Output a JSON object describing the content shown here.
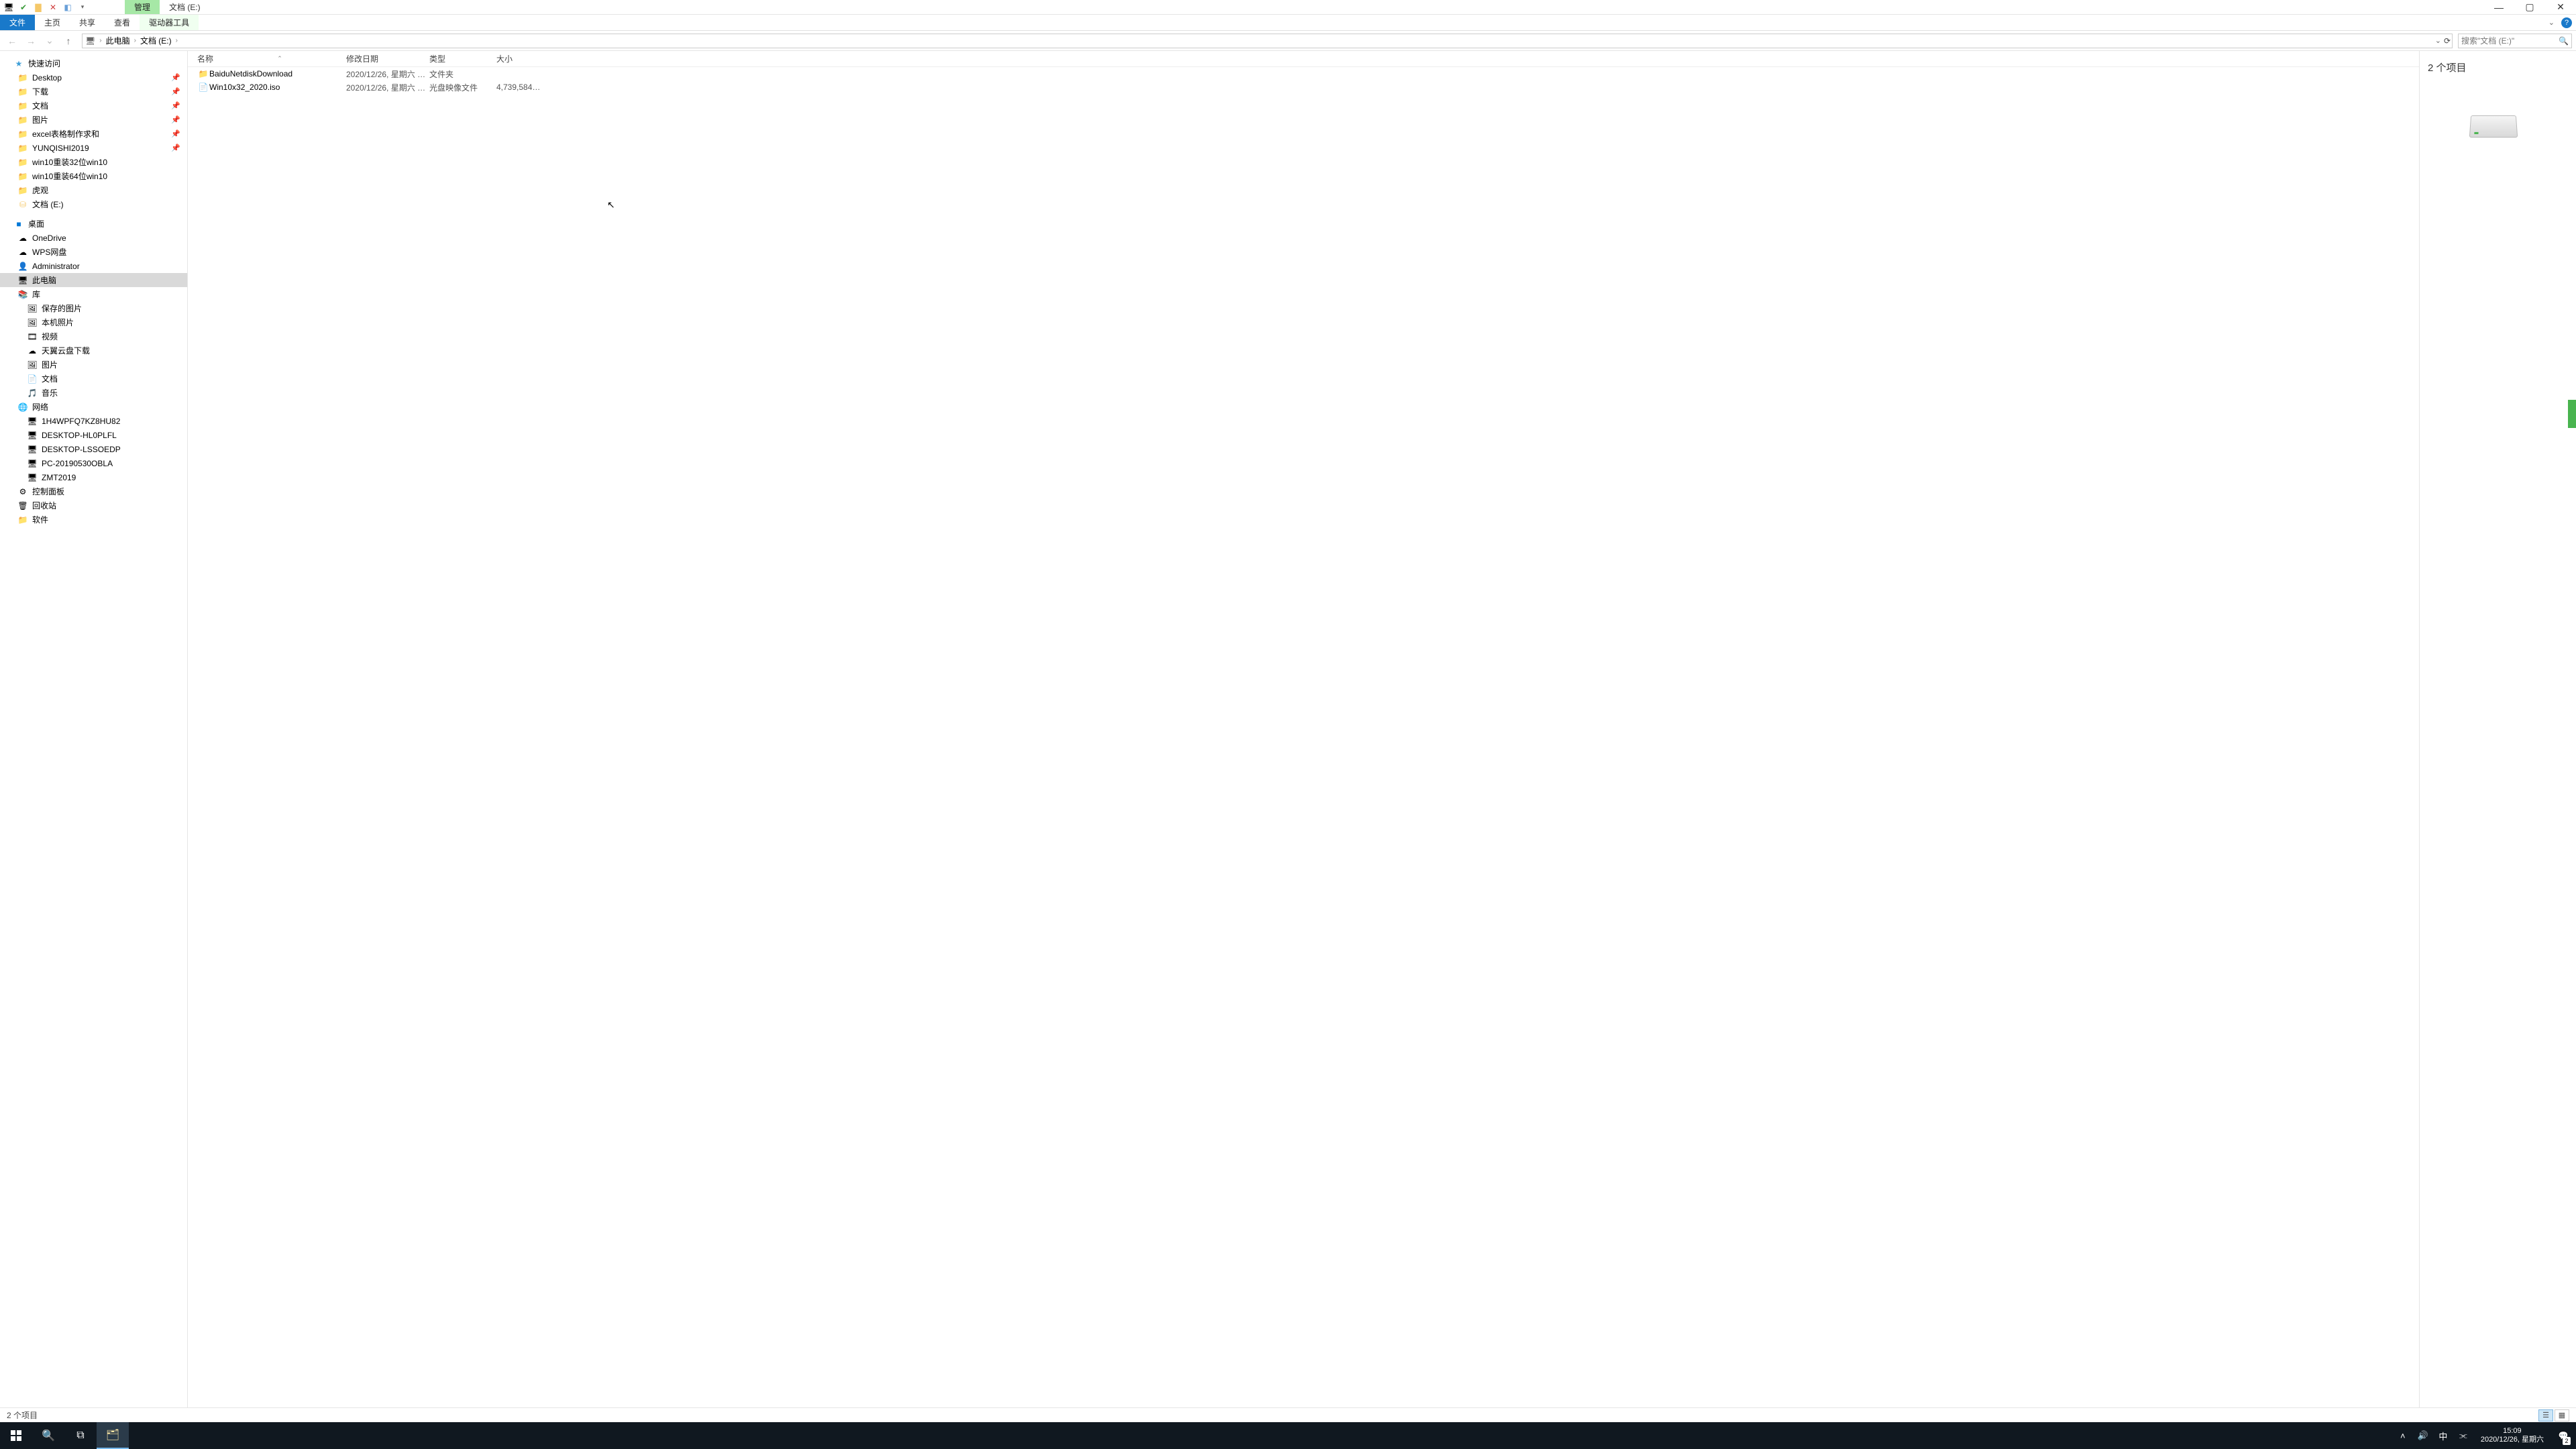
{
  "titlebar": {
    "qat_icons": [
      "pc-icon",
      "check-icon",
      "folder-icon",
      "close-x-icon",
      "props-icon",
      "dropdown-icon"
    ],
    "contextual_tab": "管理",
    "window_title": "文档 (E:)"
  },
  "ribbon": {
    "file": "文件",
    "tabs": [
      "主页",
      "共享",
      "查看"
    ],
    "contextual_sub": "驱动器工具",
    "expand_icon": "chevron-down-icon",
    "help_icon": "help-icon"
  },
  "nav": {
    "back": "←",
    "forward": "→",
    "recent": "⌄",
    "up": "↑",
    "breadcrumb": [
      "此电脑",
      "文档 (E:)"
    ],
    "addr_dropdown": "⌄",
    "refresh": "⟳",
    "search_placeholder": "搜索\"文档 (E:)\""
  },
  "columns": {
    "name": "名称",
    "date": "修改日期",
    "type": "类型",
    "size": "大小"
  },
  "rows": [
    {
      "icon": "folder",
      "name": "BaiduNetdiskDownload",
      "date": "2020/12/26, 星期六 1…",
      "type": "文件夹",
      "size": ""
    },
    {
      "icon": "file",
      "name": "Win10x32_2020.iso",
      "date": "2020/12/26, 星期六 1…",
      "type": "光盘映像文件",
      "size": "4,739,584…"
    }
  ],
  "sidebar": {
    "quick": {
      "label": "快速访问",
      "items": [
        {
          "icon": "folder",
          "label": "Desktop",
          "pin": true
        },
        {
          "icon": "folder",
          "label": "下载",
          "pin": true
        },
        {
          "icon": "folder",
          "label": "文档",
          "pin": true
        },
        {
          "icon": "folder",
          "label": "图片",
          "pin": true
        },
        {
          "icon": "folder",
          "label": "excel表格制作求和",
          "pin": true
        },
        {
          "icon": "folder",
          "label": "YUNQISHI2019",
          "pin": true
        },
        {
          "icon": "folder",
          "label": "win10重装32位win10",
          "pin": false
        },
        {
          "icon": "folder",
          "label": "win10重装64位win10",
          "pin": false
        },
        {
          "icon": "folder",
          "label": "虎观",
          "pin": false
        },
        {
          "icon": "drive",
          "label": "文档 (E:)",
          "pin": false
        }
      ]
    },
    "desktop": {
      "label": "桌面",
      "items": [
        {
          "icon": "cloud",
          "label": "OneDrive"
        },
        {
          "icon": "cloud",
          "label": "WPS网盘"
        },
        {
          "icon": "user",
          "label": "Administrator"
        },
        {
          "icon": "pc",
          "label": "此电脑",
          "selected": true
        },
        {
          "icon": "lib",
          "label": "库"
        },
        {
          "icon": "pic",
          "label": "保存的图片",
          "depth": 2
        },
        {
          "icon": "pic",
          "label": "本机照片",
          "depth": 2
        },
        {
          "icon": "video",
          "label": "视频",
          "depth": 2
        },
        {
          "icon": "cloud",
          "label": "天翼云盘下载",
          "depth": 2
        },
        {
          "icon": "pic",
          "label": "图片",
          "depth": 2
        },
        {
          "icon": "doc",
          "label": "文档",
          "depth": 2
        },
        {
          "icon": "music",
          "label": "音乐",
          "depth": 2
        },
        {
          "icon": "net",
          "label": "网络"
        },
        {
          "icon": "pc",
          "label": "1H4WPFQ7KZ8HU82",
          "depth": 2
        },
        {
          "icon": "pc",
          "label": "DESKTOP-HL0PLFL",
          "depth": 2
        },
        {
          "icon": "pc",
          "label": "DESKTOP-LSSOEDP",
          "depth": 2
        },
        {
          "icon": "pc",
          "label": "PC-20190530OBLA",
          "depth": 2
        },
        {
          "icon": "pc",
          "label": "ZMT2019",
          "depth": 2
        },
        {
          "icon": "cp",
          "label": "控制面板"
        },
        {
          "icon": "bin",
          "label": "回收站"
        },
        {
          "icon": "folder",
          "label": "软件"
        }
      ]
    }
  },
  "details": {
    "title": "2 个项目"
  },
  "statusbar": {
    "text": "2 个项目"
  },
  "taskbar": {
    "tray": {
      "ime": "中",
      "time": "15:09",
      "date": "2020/12/26, 星期六",
      "badge": "2"
    }
  }
}
